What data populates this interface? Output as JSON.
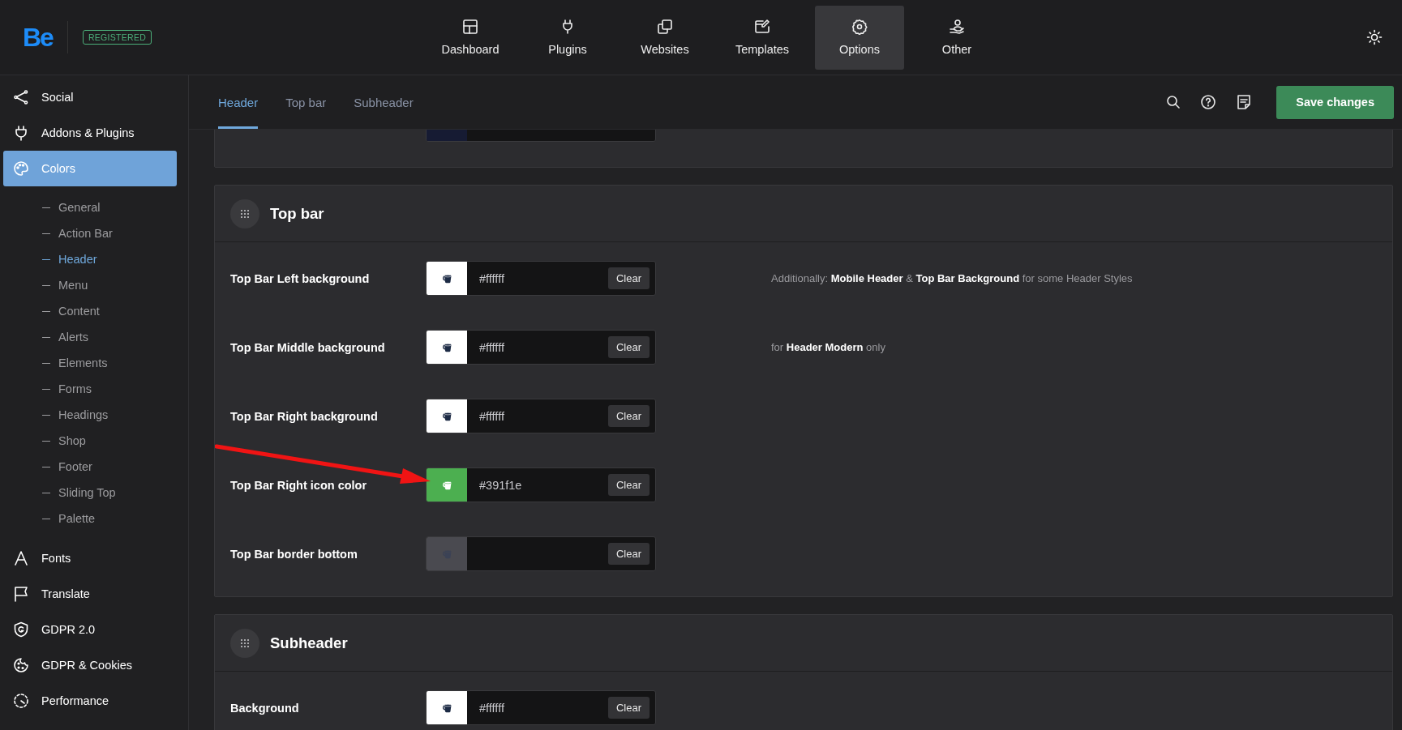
{
  "header": {
    "logo": "Be",
    "badge": "REGISTERED",
    "nav": [
      {
        "label": "Dashboard",
        "selected": false
      },
      {
        "label": "Plugins",
        "selected": false
      },
      {
        "label": "Websites",
        "selected": false
      },
      {
        "label": "Templates",
        "selected": false
      },
      {
        "label": "Options",
        "selected": true
      },
      {
        "label": "Other",
        "selected": false
      }
    ]
  },
  "sidebar": {
    "items": [
      {
        "label": "Social",
        "selected": false
      },
      {
        "label": "Addons & Plugins",
        "selected": false
      },
      {
        "label": "Colors",
        "selected": true,
        "children": [
          {
            "label": "General",
            "selected": false
          },
          {
            "label": "Action Bar",
            "selected": false
          },
          {
            "label": "Header",
            "selected": true
          },
          {
            "label": "Menu",
            "selected": false
          },
          {
            "label": "Content",
            "selected": false
          },
          {
            "label": "Alerts",
            "selected": false
          },
          {
            "label": "Elements",
            "selected": false
          },
          {
            "label": "Forms",
            "selected": false
          },
          {
            "label": "Headings",
            "selected": false
          },
          {
            "label": "Shop",
            "selected": false
          },
          {
            "label": "Footer",
            "selected": false
          },
          {
            "label": "Sliding Top",
            "selected": false
          },
          {
            "label": "Palette",
            "selected": false
          }
        ]
      },
      {
        "label": "Fonts",
        "selected": false
      },
      {
        "label": "Translate",
        "selected": false
      },
      {
        "label": "GDPR 2.0",
        "selected": false
      },
      {
        "label": "GDPR & Cookies",
        "selected": false
      },
      {
        "label": "Performance",
        "selected": false
      }
    ]
  },
  "toolbar": {
    "tabs": [
      {
        "label": "Header",
        "selected": true
      },
      {
        "label": "Top bar",
        "selected": false
      },
      {
        "label": "Subheader",
        "selected": false
      }
    ],
    "save_button": "Save changes"
  },
  "sections": [
    {
      "kind": "partial",
      "rows": [
        {
          "color": "#161b33"
        }
      ]
    },
    {
      "kind": "full",
      "title": "Top bar",
      "rows": [
        {
          "label": "Top Bar Left background",
          "color": "#ffffff",
          "value": "#ffffff",
          "clear": "Clear",
          "note": "Additionally: **Mobile Header** & **Top Bar Background** for some Header Styles",
          "pointed": false
        },
        {
          "label": "Top Bar Middle background",
          "color": "#ffffff",
          "value": "#ffffff",
          "clear": "Clear",
          "note": "for **Header Modern** only",
          "pointed": false
        },
        {
          "label": "Top Bar Right background",
          "color": "#ffffff",
          "value": "#ffffff",
          "clear": "Clear",
          "pointed": false
        },
        {
          "label": "Top Bar Right icon color",
          "color": "#4caf50",
          "value": "#391f1e",
          "clear": "Clear",
          "pointed": true
        },
        {
          "label": "Top Bar border bottom",
          "color": "#4a4a50",
          "clear": "Clear",
          "pointed": false
        }
      ]
    },
    {
      "kind": "full",
      "title": "Subheader",
      "rows": [
        {
          "label": "Background",
          "color": "#ffffff",
          "value": "#ffffff",
          "clear": "Clear",
          "pointed": false
        }
      ]
    }
  ]
}
